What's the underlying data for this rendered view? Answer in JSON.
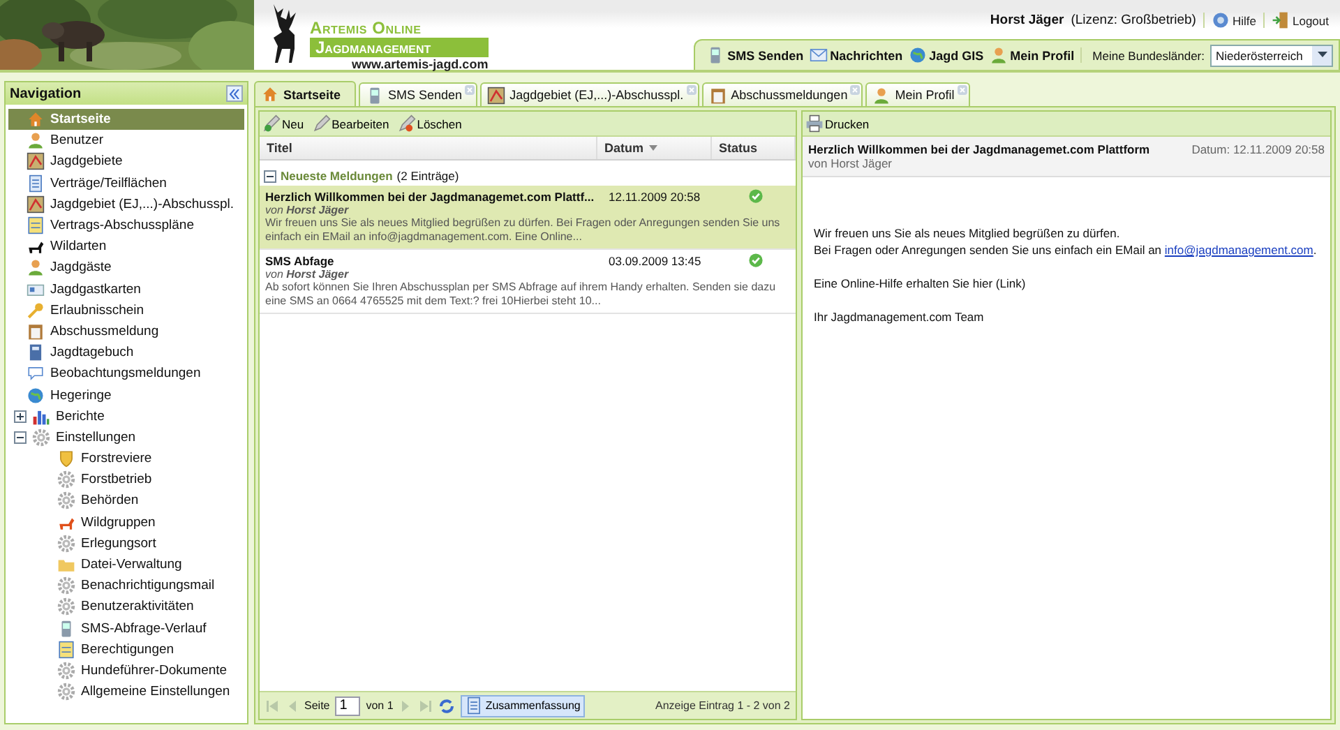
{
  "header": {
    "logo": {
      "line1": "Artemis Online",
      "line2": "Jagdmanagement",
      "url": "www.artemis-jagd.com"
    },
    "user": {
      "name": "Horst Jäger",
      "license": "(Lizenz: Großbetrieb)"
    },
    "links": [
      {
        "label": "Hilfe"
      },
      {
        "label": "Logout"
      }
    ],
    "toolbar": [
      {
        "label": "SMS Senden"
      },
      {
        "label": "Nachrichten"
      },
      {
        "label": "Jagd GIS"
      },
      {
        "label": "Mein Profil"
      }
    ],
    "region_label": "Meine Bundesländer:",
    "region_value": "Niederösterreich"
  },
  "navigation": {
    "title": "Navigation",
    "items": [
      {
        "label": "Startseite",
        "selected": true
      },
      {
        "label": "Benutzer",
        "selected": false
      },
      {
        "label": "Jagdgebiete",
        "selected": false
      },
      {
        "label": "Verträge/Teilflächen",
        "selected": false
      },
      {
        "label": "Jagdgebiet (EJ,...)-Abschusspl.",
        "selected": false
      },
      {
        "label": "Vertrags-Abschusspläne",
        "selected": false
      },
      {
        "label": "Wildarten",
        "selected": false
      },
      {
        "label": "Jagdgäste",
        "selected": false
      },
      {
        "label": "Jagdgastkarten",
        "selected": false
      },
      {
        "label": "Erlaubnisschein",
        "selected": false
      },
      {
        "label": "Abschussmeldung",
        "selected": false
      },
      {
        "label": "Jagdtagebuch",
        "selected": false
      },
      {
        "label": "Beobachtungsmeldungen",
        "selected": false
      },
      {
        "label": "Hegeringe",
        "selected": false
      },
      {
        "label": "Berichte",
        "selected": false,
        "expanded": false
      },
      {
        "label": "Einstellungen",
        "selected": false,
        "expanded": true,
        "children": [
          {
            "label": "Forstreviere",
            "selected": false
          },
          {
            "label": "Forstbetrieb",
            "selected": false
          },
          {
            "label": "Behörden",
            "selected": false
          },
          {
            "label": "Wildgruppen",
            "selected": false
          },
          {
            "label": "Erlegungsort",
            "selected": false
          },
          {
            "label": "Datei-Verwaltung",
            "selected": false
          },
          {
            "label": "Benachrichtigungsmail",
            "selected": false
          },
          {
            "label": "Benutzeraktivitäten",
            "selected": false
          },
          {
            "label": "SMS-Abfrage-Verlauf",
            "selected": false
          },
          {
            "label": "Berechtigungen",
            "selected": false
          },
          {
            "label": "Hundeführer-Dokumente",
            "selected": false
          },
          {
            "label": "Allgemeine Einstellungen",
            "selected": false
          }
        ]
      }
    ]
  },
  "tabs": [
    {
      "label": "Startseite",
      "selected": true,
      "closable": false
    },
    {
      "label": "SMS Senden",
      "selected": false,
      "closable": true
    },
    {
      "label": "Jagdgebiet (EJ,...)-Abschusspl.",
      "selected": false,
      "closable": true
    },
    {
      "label": "Abschussmeldungen",
      "selected": false,
      "closable": true
    },
    {
      "label": "Mein Profil",
      "selected": false,
      "closable": true
    }
  ],
  "grid": {
    "toolbar": [
      {
        "label": "Neu"
      },
      {
        "label": "Bearbeiten"
      },
      {
        "label": "Löschen"
      }
    ],
    "columns": [
      {
        "label": "Titel"
      },
      {
        "label": "Datum",
        "sorted": true
      },
      {
        "label": "Status"
      }
    ],
    "group": {
      "title": "Neueste Meldungen",
      "count": "(2 Einträge)",
      "expanded": true
    },
    "rows": [
      {
        "title": "Herzlich Willkommen bei der Jagdmanagemet.com Plattf...",
        "by": "von",
        "author": "Horst Jäger",
        "date": "12.11.2009 20:58",
        "completed": true,
        "selected": true,
        "preview": "Wir freuen uns Sie als neues Mitglied begrüßen zu dürfen. Bei Fragen oder Anregungen senden Sie uns einfach ein EMail an info@jagdmanagement.com. Eine Online..."
      },
      {
        "title": "SMS Abfage",
        "by": "von",
        "author": "Horst Jäger",
        "date": "03.09.2009 13:45",
        "completed": true,
        "selected": false,
        "preview": "Ab sofort können Sie Ihren Abschussplan per SMS Abfrage auf ihrem Handy erhalten. Senden sie dazu eine SMS an 0664 4765525 mit dem Text:? frei 10Hierbei steht 10..."
      }
    ],
    "pager": {
      "page_label": "Seite",
      "page": "1",
      "of": "von 1",
      "summary": "Zusammenfassung",
      "display": "Anzeige Eintrag 1 - 2 von 2"
    }
  },
  "detail": {
    "toolbar": "Drucken",
    "title": "Herzlich Willkommen bei der Jagdmanagemet.com Plattform",
    "author": "von Horst Jäger",
    "date": "Datum: 12.11.2009 20:58",
    "intro": "Wir freuen uns Sie als neues Mitglied begrüßen zu dürfen.\nBei Fragen oder Anregungen senden Sie uns einfach ein EMail an",
    "link": "info@jagdmanagement.com",
    "after_link": ".",
    "paragraphs": [
      "Eine Online-Hilfe erhalten Sie hier (Link)",
      "Ihr Jagdmanagement.com Team"
    ]
  }
}
